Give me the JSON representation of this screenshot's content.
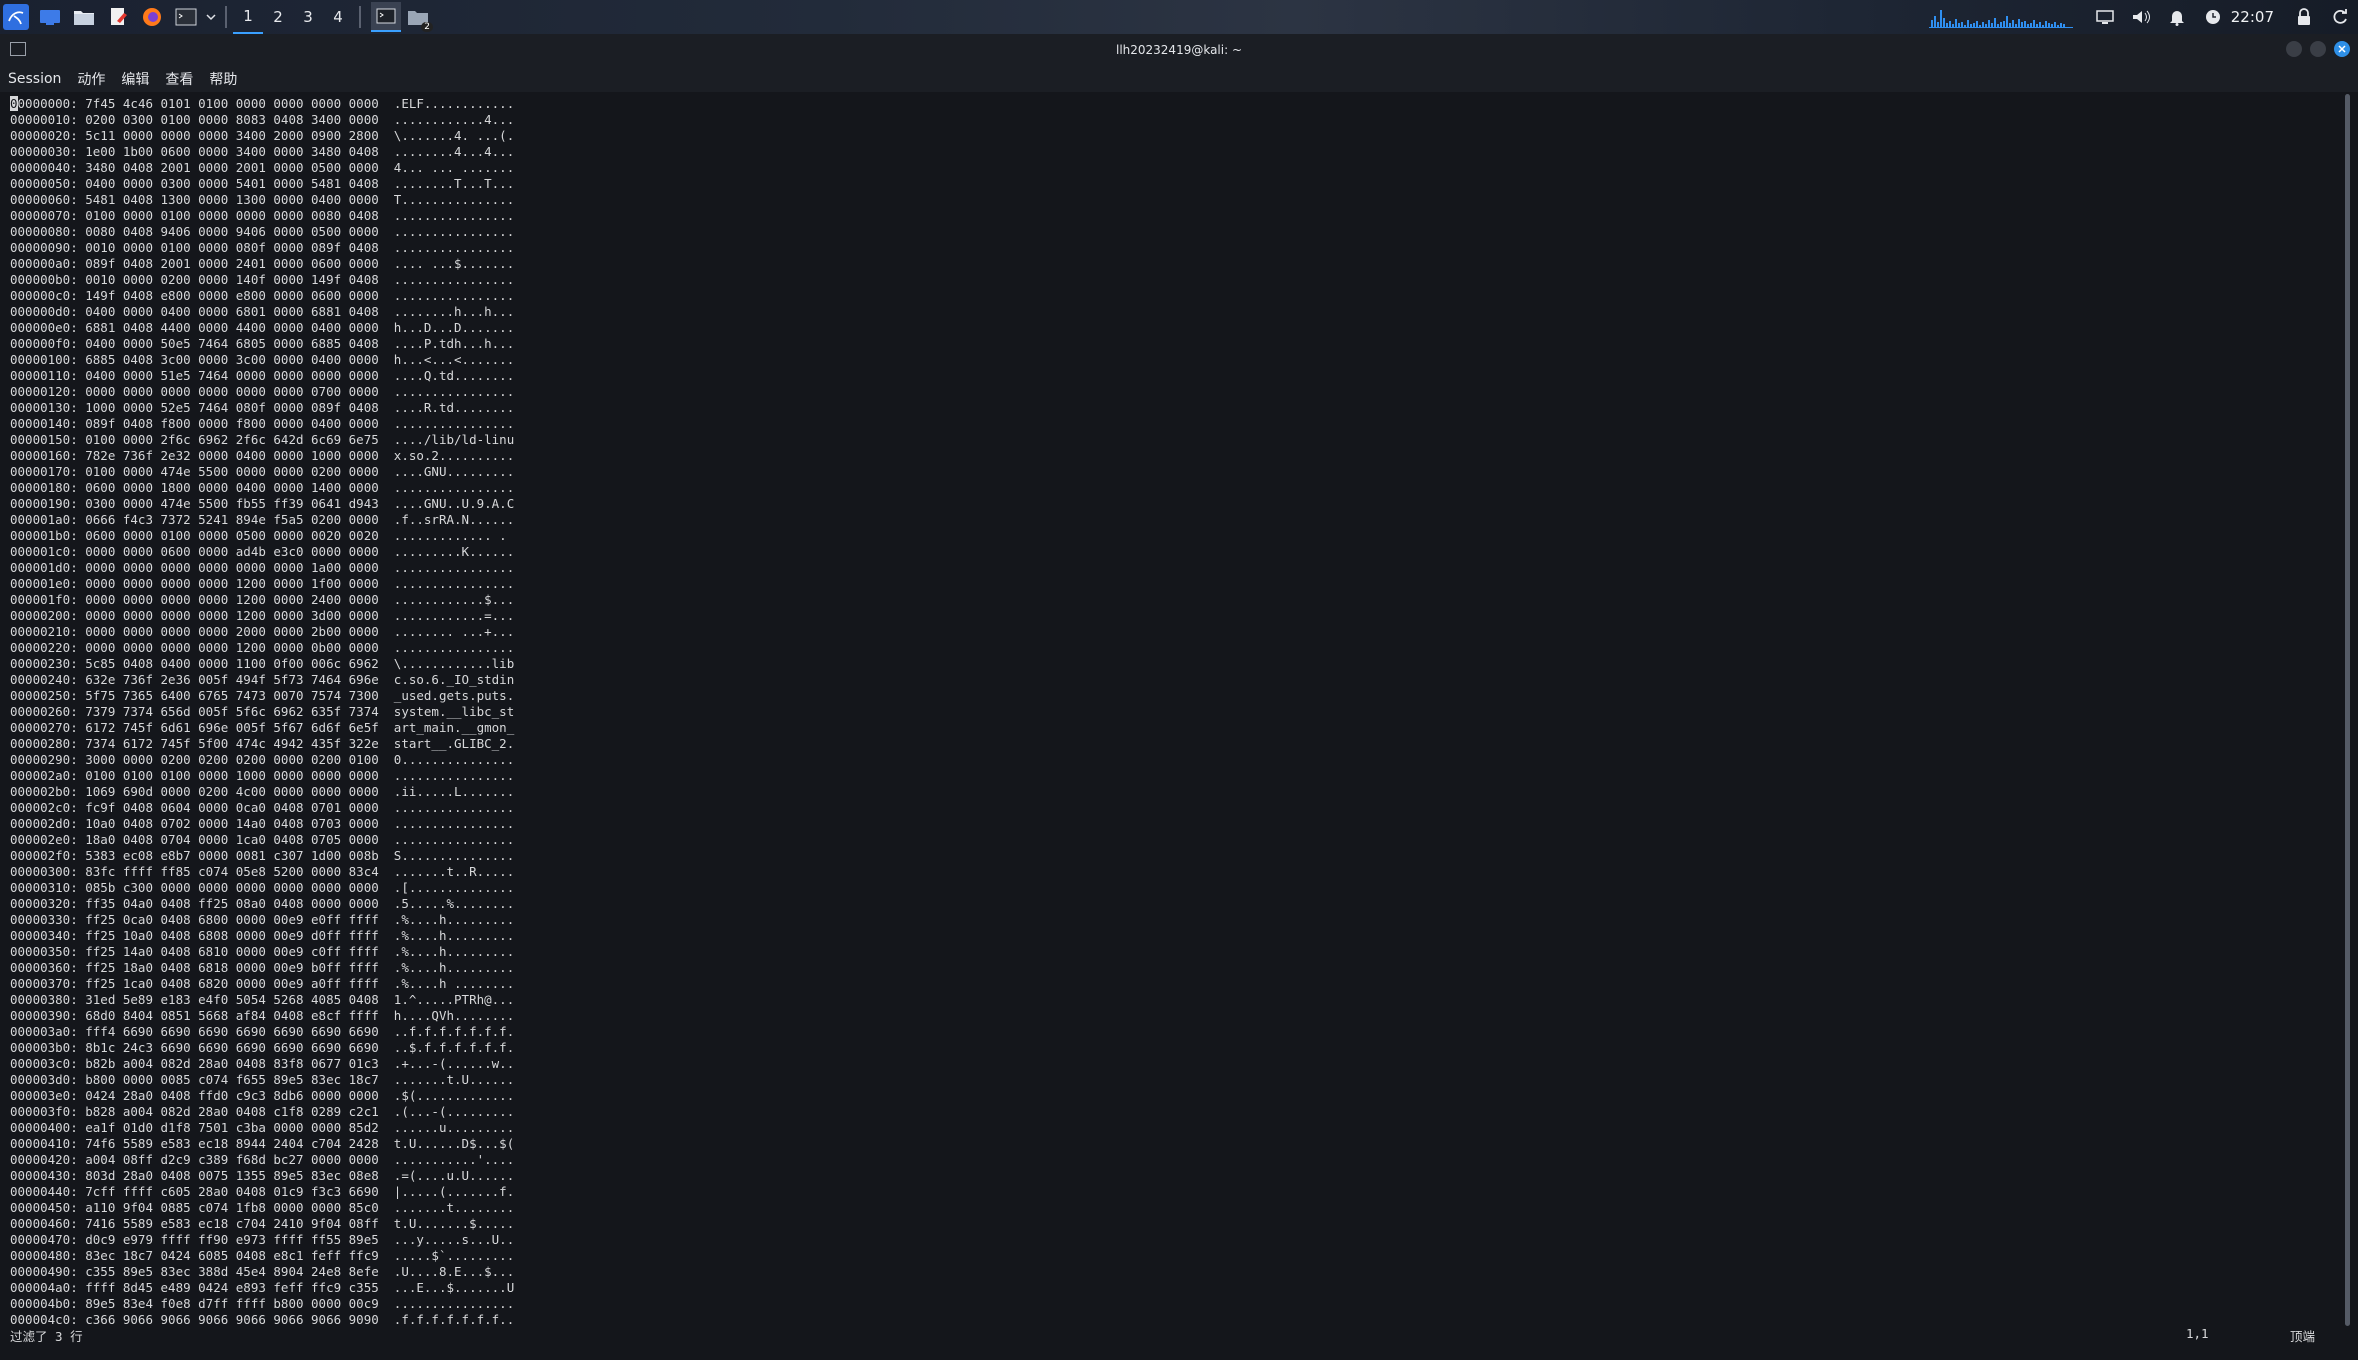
{
  "taskbar": {
    "workspaces": [
      "1",
      "2",
      "3",
      "4"
    ],
    "active_workspace": "1",
    "task_badge": "2",
    "clock": "22:07",
    "colors": {
      "accent": "#3aa0ff",
      "kali_blue": "#2f6fe0"
    }
  },
  "window": {
    "title": "llh20232419@kali: ~"
  },
  "menu": {
    "items": [
      "Session",
      "动作",
      "编辑",
      "查看",
      "帮助"
    ]
  },
  "hexdump": {
    "lines": [
      "00000000: 7f45 4c46 0101 0100 0000 0000 0000 0000  .ELF............",
      "00000010: 0200 0300 0100 0000 8083 0408 3400 0000  ............4...",
      "00000020: 5c11 0000 0000 0000 3400 2000 0900 2800  \\.......4. ...(.",
      "00000030: 1e00 1b00 0600 0000 3400 0000 3480 0408  ........4...4...",
      "00000040: 3480 0408 2001 0000 2001 0000 0500 0000  4... ... .......",
      "00000050: 0400 0000 0300 0000 5401 0000 5481 0408  ........T...T...",
      "00000060: 5481 0408 1300 0000 1300 0000 0400 0000  T...............",
      "00000070: 0100 0000 0100 0000 0000 0000 0080 0408  ................",
      "00000080: 0080 0408 9406 0000 9406 0000 0500 0000  ................",
      "00000090: 0010 0000 0100 0000 080f 0000 089f 0408  ................",
      "000000a0: 089f 0408 2001 0000 2401 0000 0600 0000  .... ...$.......",
      "000000b0: 0010 0000 0200 0000 140f 0000 149f 0408  ................",
      "000000c0: 149f 0408 e800 0000 e800 0000 0600 0000  ................",
      "000000d0: 0400 0000 0400 0000 6801 0000 6881 0408  ........h...h...",
      "000000e0: 6881 0408 4400 0000 4400 0000 0400 0000  h...D...D.......",
      "000000f0: 0400 0000 50e5 7464 6805 0000 6885 0408  ....P.tdh...h...",
      "00000100: 6885 0408 3c00 0000 3c00 0000 0400 0000  h...<...<.......",
      "00000110: 0400 0000 51e5 7464 0000 0000 0000 0000  ....Q.td........",
      "00000120: 0000 0000 0000 0000 0000 0000 0700 0000  ................",
      "00000130: 1000 0000 52e5 7464 080f 0000 089f 0408  ....R.td........",
      "00000140: 089f 0408 f800 0000 f800 0000 0400 0000  ................",
      "00000150: 0100 0000 2f6c 6962 2f6c 642d 6c69 6e75  ..../lib/ld-linu",
      "00000160: 782e 736f 2e32 0000 0400 0000 1000 0000  x.so.2..........",
      "00000170: 0100 0000 474e 5500 0000 0000 0200 0000  ....GNU.........",
      "00000180: 0600 0000 1800 0000 0400 0000 1400 0000  ................",
      "00000190: 0300 0000 474e 5500 fb55 ff39 0641 d943  ....GNU..U.9.A.C",
      "000001a0: 0666 f4c3 7372 5241 894e f5a5 0200 0000  .f..srRA.N......",
      "000001b0: 0600 0000 0100 0000 0500 0000 0020 0020  ............. . ",
      "000001c0: 0000 0000 0600 0000 ad4b e3c0 0000 0000  .........K......",
      "000001d0: 0000 0000 0000 0000 0000 0000 1a00 0000  ................",
      "000001e0: 0000 0000 0000 0000 1200 0000 1f00 0000  ................",
      "000001f0: 0000 0000 0000 0000 1200 0000 2400 0000  ............$...",
      "00000200: 0000 0000 0000 0000 1200 0000 3d00 0000  ............=...",
      "00000210: 0000 0000 0000 0000 2000 0000 2b00 0000  ........ ...+...",
      "00000220: 0000 0000 0000 0000 1200 0000 0b00 0000  ................",
      "00000230: 5c85 0408 0400 0000 1100 0f00 006c 6962  \\............lib",
      "00000240: 632e 736f 2e36 005f 494f 5f73 7464 696e  c.so.6._IO_stdin",
      "00000250: 5f75 7365 6400 6765 7473 0070 7574 7300  _used.gets.puts.",
      "00000260: 7379 7374 656d 005f 5f6c 6962 635f 7374  system.__libc_st",
      "00000270: 6172 745f 6d61 696e 005f 5f67 6d6f 6e5f  art_main.__gmon_",
      "00000280: 7374 6172 745f 5f00 474c 4942 435f 322e  start__.GLIBC_2.",
      "00000290: 3000 0000 0200 0200 0200 0000 0200 0100  0...............",
      "000002a0: 0100 0100 0100 0000 1000 0000 0000 0000  ................",
      "000002b0: 1069 690d 0000 0200 4c00 0000 0000 0000  .ii.....L.......",
      "000002c0: fc9f 0408 0604 0000 0ca0 0408 0701 0000  ................",
      "000002d0: 10a0 0408 0702 0000 14a0 0408 0703 0000  ................",
      "000002e0: 18a0 0408 0704 0000 1ca0 0408 0705 0000  ................",
      "000002f0: 5383 ec08 e8b7 0000 0081 c307 1d00 008b  S...............",
      "00000300: 83fc ffff ff85 c074 05e8 5200 0000 83c4  .......t..R.....",
      "00000310: 085b c300 0000 0000 0000 0000 0000 0000  .[..............",
      "00000320: ff35 04a0 0408 ff25 08a0 0408 0000 0000  .5.....%........",
      "00000330: ff25 0ca0 0408 6800 0000 00e9 e0ff ffff  .%....h.........",
      "00000340: ff25 10a0 0408 6808 0000 00e9 d0ff ffff  .%....h.........",
      "00000350: ff25 14a0 0408 6810 0000 00e9 c0ff ffff  .%....h.........",
      "00000360: ff25 18a0 0408 6818 0000 00e9 b0ff ffff  .%....h.........",
      "00000370: ff25 1ca0 0408 6820 0000 00e9 a0ff ffff  .%....h ........",
      "00000380: 31ed 5e89 e183 e4f0 5054 5268 4085 0408  1.^.....PTRh@...",
      "00000390: 68d0 8404 0851 5668 af84 0408 e8cf ffff  h....QVh........",
      "000003a0: fff4 6690 6690 6690 6690 6690 6690 6690  ..f.f.f.f.f.f.f.",
      "000003b0: 8b1c 24c3 6690 6690 6690 6690 6690 6690  ..$.f.f.f.f.f.f.",
      "000003c0: b82b a004 082d 28a0 0408 83f8 0677 01c3  .+...-(......w..",
      "000003d0: b800 0000 0085 c074 f655 89e5 83ec 18c7  .......t.U......",
      "000003e0: 0424 28a0 0408 ffd0 c9c3 8db6 0000 0000  .$(.............",
      "000003f0: b828 a004 082d 28a0 0408 c1f8 0289 c2c1  .(...-(.........",
      "00000400: ea1f 01d0 d1f8 7501 c3ba 0000 0000 85d2  ......u.........",
      "00000410: 74f6 5589 e583 ec18 8944 2404 c704 2428  t.U......D$...$(",
      "00000420: a004 08ff d2c9 c389 f68d bc27 0000 0000  ...........'....",
      "00000430: 803d 28a0 0408 0075 1355 89e5 83ec 08e8  .=(....u.U......",
      "00000440: 7cff ffff c605 28a0 0408 01c9 f3c3 6690  |.....(.......f.",
      "00000450: a110 9f04 0885 c074 1fb8 0000 0000 85c0  .......t........",
      "00000460: 7416 5589 e583 ec18 c704 2410 9f04 08ff  t.U.......$.....",
      "00000470: d0c9 e979 ffff ff90 e973 ffff ff55 89e5  ...y.....s...U..",
      "00000480: 83ec 18c7 0424 6085 0408 e8c1 feff ffc9  .....$`.........",
      "00000490: c355 89e5 83ec 388d 45e4 8904 24e8 8efe  .U....8.E...$...",
      "000004a0: ffff 8d45 e489 0424 e893 feff ffc9 c355  ...E...$.......U",
      "000004b0: 89e5 83e4 f0e8 d7ff ffff b800 0000 00c9  ................",
      "000004c0: c366 9066 9066 9066 9066 9066 9066 9090  .f.f.f.f.f.f.f.."
    ]
  },
  "status": {
    "message": "过滤了 3 行",
    "position": "1,1",
    "scroll": "顶端"
  }
}
